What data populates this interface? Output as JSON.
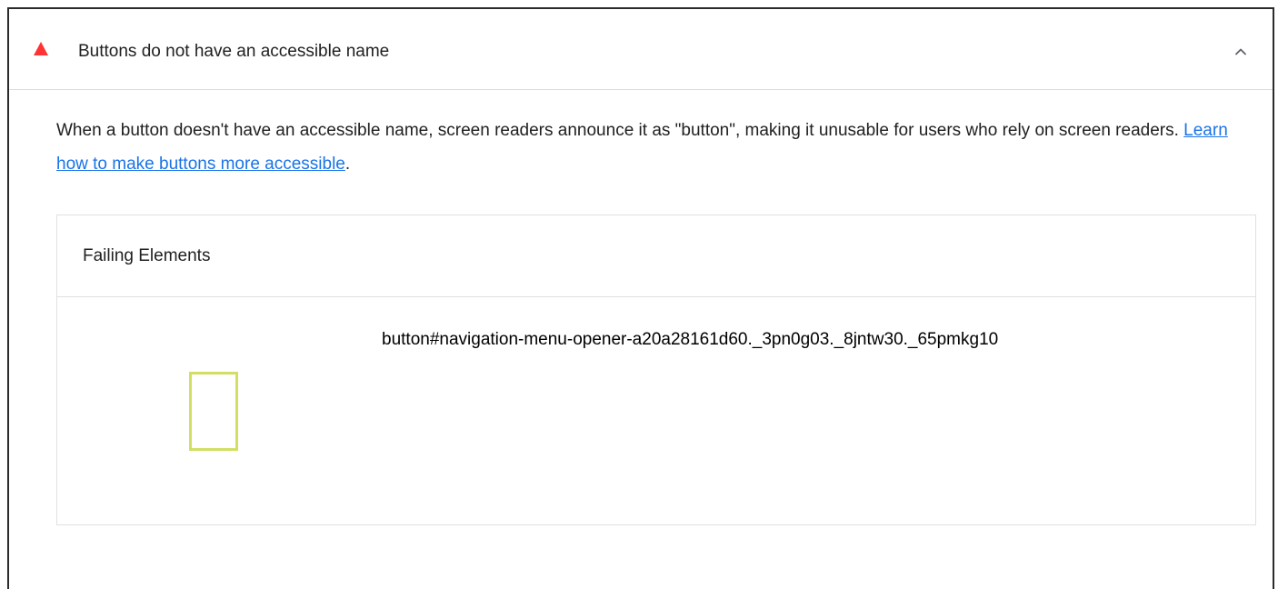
{
  "audit": {
    "title": "Buttons do not have an accessible name",
    "status_icon": "warning-triangle-icon",
    "status_color": "#ff3333",
    "expanded": true,
    "description_prefix": "When a button doesn't have an accessible name, screen readers announce it as \"button\", making it unusable for users who rely on screen readers. ",
    "learn_more_text": "Learn how to make buttons more accessible",
    "description_suffix": "."
  },
  "details": {
    "header_label": "Failing Elements",
    "items": [
      {
        "selector": "button#navigation-menu-opener-a20a28161d60._3pn0g03._8jntw30._65pmkg10",
        "highlight_color": "#d2df64"
      }
    ]
  },
  "colors": {
    "link": "#1a73e8",
    "border": "#e0e0e0",
    "panel_border": "#2b2b2b"
  }
}
